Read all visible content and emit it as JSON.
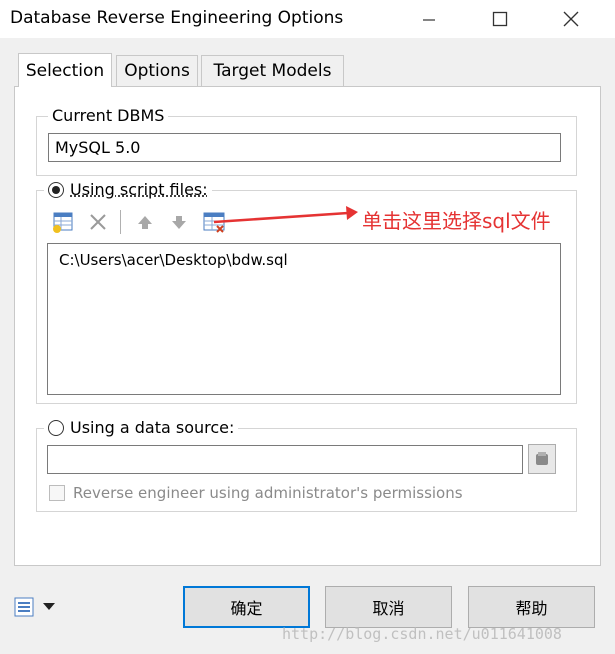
{
  "window": {
    "title": "Database Reverse Engineering Options"
  },
  "tabs": [
    {
      "label": "Selection",
      "active": true
    },
    {
      "label": "Options",
      "active": false
    },
    {
      "label": "Target Models",
      "active": false
    }
  ],
  "dbms": {
    "label": "Current DBMS",
    "value": "MySQL 5.0"
  },
  "script_files": {
    "label": "Using script files:",
    "selected": true,
    "toolbar_icons": [
      "add-file-icon",
      "delete-icon",
      "move-up-icon",
      "move-down-icon",
      "select-file-icon"
    ],
    "files": [
      "C:\\Users\\acer\\Desktop\\bdw.sql"
    ]
  },
  "annotation": {
    "text": "单击这里选择sql文件",
    "color": "#e53333"
  },
  "data_source": {
    "label": "Using a data source:",
    "selected": false,
    "value": "",
    "checkbox_label": "Reverse engineer using administrator's permissions",
    "checkbox_checked": false
  },
  "buttons": {
    "ok": "确定",
    "cancel": "取消",
    "help": "帮助"
  },
  "watermark": "http://blog.csdn.net/u011641008",
  "colors": {
    "accent": "#0078d7",
    "annotation": "#e53333"
  }
}
